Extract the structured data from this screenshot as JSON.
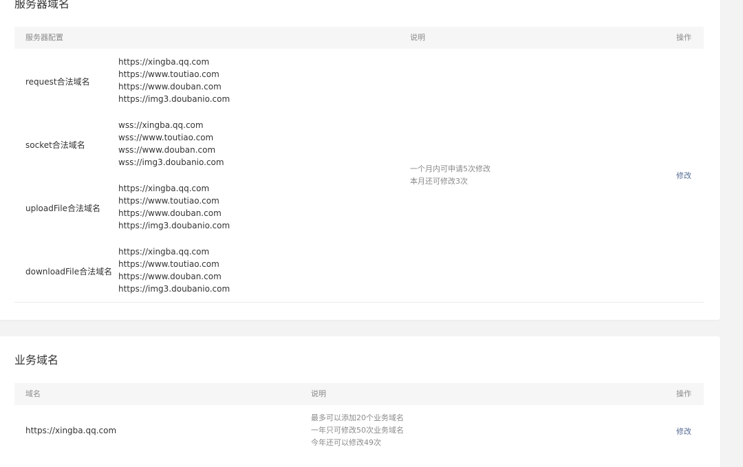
{
  "server_section": {
    "title": "服务器域名",
    "columns": {
      "config": "服务器配置",
      "description": "说明",
      "action": "操作"
    },
    "rows": [
      {
        "label": "request合法域名",
        "urls": [
          "https://xingba.qq.com",
          "https://www.toutiao.com",
          "https://www.douban.com",
          "https://img3.doubanio.com"
        ]
      },
      {
        "label": "socket合法域名",
        "urls": [
          "wss://xingba.qq.com",
          "wss://www.toutiao.com",
          "wss://www.douban.com",
          "wss://img3.doubanio.com"
        ]
      },
      {
        "label": "uploadFile合法域名",
        "urls": [
          "https://xingba.qq.com",
          "https://www.toutiao.com",
          "https://www.douban.com",
          "https://img3.doubanio.com"
        ]
      },
      {
        "label": "downloadFile合法域名",
        "urls": [
          "https://xingba.qq.com",
          "https://www.toutiao.com",
          "https://www.douban.com",
          "https://img3.doubanio.com"
        ]
      }
    ],
    "note": [
      "一个月内可申请5次修改",
      "本月还可修改3次"
    ],
    "action_label": "修改"
  },
  "business_section": {
    "title": "业务域名",
    "columns": {
      "domain": "域名",
      "description": "说明",
      "action": "操作"
    },
    "rows": [
      {
        "domain": "https://xingba.qq.com",
        "note": [
          "最多可以添加20个业务域名",
          "一年只可修改50次业务域名",
          "今年还可以修改49次"
        ],
        "action_label": "修改"
      }
    ]
  }
}
